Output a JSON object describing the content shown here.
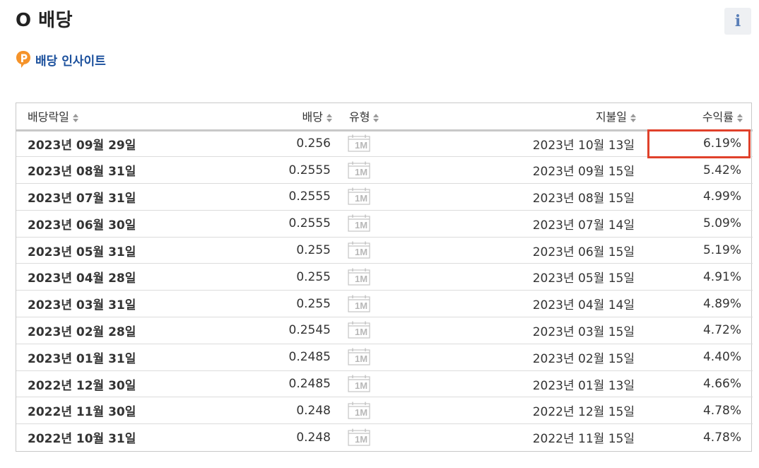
{
  "header": {
    "title": "O 배당",
    "info_label": "i"
  },
  "insight": {
    "label": "배당 인사이트"
  },
  "table": {
    "columns": [
      "배당락일",
      "배당",
      "유형",
      "지불일",
      "수익률"
    ],
    "type_icon_label": "1M",
    "rows": [
      {
        "ex_date": "2023년 09월 29일",
        "dividend": "0.256",
        "pay_date": "2023년 10월 13일",
        "yield": "6.19%"
      },
      {
        "ex_date": "2023년 08월 31일",
        "dividend": "0.2555",
        "pay_date": "2023년 09월 15일",
        "yield": "5.42%"
      },
      {
        "ex_date": "2023년 07월 31일",
        "dividend": "0.2555",
        "pay_date": "2023년 08월 15일",
        "yield": "4.99%"
      },
      {
        "ex_date": "2023년 06월 30일",
        "dividend": "0.2555",
        "pay_date": "2023년 07월 14일",
        "yield": "5.09%"
      },
      {
        "ex_date": "2023년 05월 31일",
        "dividend": "0.255",
        "pay_date": "2023년 06월 15일",
        "yield": "5.19%"
      },
      {
        "ex_date": "2023년 04월 28일",
        "dividend": "0.255",
        "pay_date": "2023년 05월 15일",
        "yield": "4.91%"
      },
      {
        "ex_date": "2023년 03월 31일",
        "dividend": "0.255",
        "pay_date": "2023년 04월 14일",
        "yield": "4.89%"
      },
      {
        "ex_date": "2023년 02월 28일",
        "dividend": "0.2545",
        "pay_date": "2023년 03월 15일",
        "yield": "4.72%"
      },
      {
        "ex_date": "2023년 01월 31일",
        "dividend": "0.2485",
        "pay_date": "2023년 02월 15일",
        "yield": "4.40%"
      },
      {
        "ex_date": "2022년 12월 30일",
        "dividend": "0.2485",
        "pay_date": "2023년 01월 13일",
        "yield": "4.66%"
      },
      {
        "ex_date": "2022년 11월 30일",
        "dividend": "0.248",
        "pay_date": "2022년 12월 15일",
        "yield": "4.78%"
      },
      {
        "ex_date": "2022년 10월 31일",
        "dividend": "0.248",
        "pay_date": "2022년 11월 15일",
        "yield": "4.78%"
      }
    ]
  },
  "colors": {
    "highlight": "#e0412b",
    "link": "#1a4f9c",
    "insight_icon": "#f5932a",
    "info_icon": "#5a7fb8"
  }
}
